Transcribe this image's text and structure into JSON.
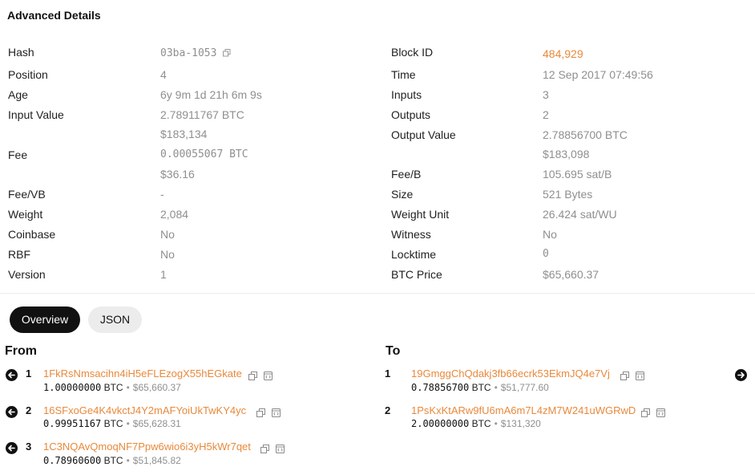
{
  "title": "Advanced Details",
  "left_details": [
    {
      "label": "Hash",
      "value": "03ba-1053",
      "copy": true,
      "mono": true
    },
    {
      "label": "Position",
      "value": "4"
    },
    {
      "label": "Age",
      "value": "6y 9m 1d 21h 6m 9s"
    },
    {
      "label": "Input Value",
      "value": "2.78911767 BTC",
      "sub": "$183,134"
    },
    {
      "label": "Fee",
      "value": "0.00055067 BTC",
      "sub": "$36.16"
    },
    {
      "label": "Fee/VB",
      "value": "-"
    },
    {
      "label": "Weight",
      "value": "2,084"
    },
    {
      "label": "Coinbase",
      "value": "No"
    },
    {
      "label": "RBF",
      "value": "No"
    },
    {
      "label": "Version",
      "value": "1"
    }
  ],
  "right_details": [
    {
      "label": "Block ID",
      "value": "484,929",
      "link": true
    },
    {
      "label": "Time",
      "value": "12 Sep 2017 07:49:56"
    },
    {
      "label": "Inputs",
      "value": "3"
    },
    {
      "label": "Outputs",
      "value": "2"
    },
    {
      "label": "Output Value",
      "value": "2.78856700 BTC",
      "sub": "$183,098"
    },
    {
      "label": "Fee/B",
      "value": "105.695 sat/B"
    },
    {
      "label": "Size",
      "value": "521 Bytes"
    },
    {
      "label": "Weight Unit",
      "value": "26.424 sat/WU"
    },
    {
      "label": "Witness",
      "value": "No"
    },
    {
      "label": "Locktime",
      "value": "0"
    },
    {
      "label": "BTC Price",
      "value": "$65,660.37"
    }
  ],
  "tabs": [
    "Overview",
    "JSON"
  ],
  "from_label": "From",
  "to_label": "To",
  "inputs": [
    {
      "index": "1",
      "address": "1FkRsNmsacihn4iH5eFLEzogX55hEGkate",
      "btc": "1.00000000",
      "unit": "BTC",
      "usd": "$65,660.37"
    },
    {
      "index": "2",
      "address": "16SFxoGe4K4vkctJ4Y2mAFYoiUkTwKY4yc",
      "btc": "0.99951167",
      "unit": "BTC",
      "usd": "$65,628.31"
    },
    {
      "index": "3",
      "address": "1C3NQAvQmoqNF7Ppw6wio6i3yH5kWr7qet",
      "btc": "0.78960600",
      "unit": "BTC",
      "usd": "$51,845.82"
    }
  ],
  "outputs": [
    {
      "index": "1",
      "address": "19GmggChQdakj3fb66ecrk53EkmJQ4e7Vj",
      "btc": "0.78856700",
      "unit": "BTC",
      "usd": "$51,777.60"
    },
    {
      "index": "2",
      "address": "1PsKxKtARw9fU6mA6m7L4zM7W241uWGRwD",
      "btc": "2.00000000",
      "unit": "BTC",
      "usd": "$131,320"
    }
  ],
  "dot": "•",
  "icons": {
    "copy": "copy-icon",
    "explorer": "explorer-icon",
    "arrow_left": "arrow-left-icon",
    "arrow_right": "arrow-right-icon"
  },
  "colors": {
    "link": "#e8893b",
    "muted": "#8f8f8f",
    "active_tab": "#111111"
  }
}
